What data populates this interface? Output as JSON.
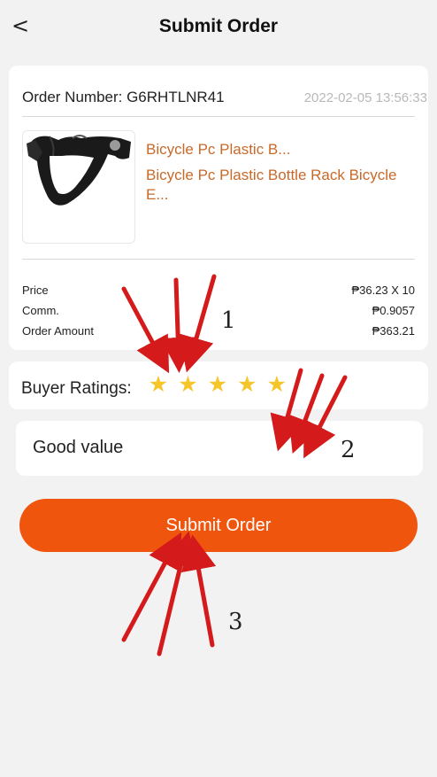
{
  "header": {
    "back_glyph": "<",
    "title": "Submit Order"
  },
  "order": {
    "number_label": "Order Number: G6RHTLNR41",
    "time": "2022-02-05 13:56:33",
    "product_title_short": "Bicycle Pc Plastic B...",
    "product_title_long": "Bicycle Pc Plastic Bottle Rack Bicycle E...",
    "product_image_icon": "bottle-cage-image",
    "summary": [
      {
        "label": "Price",
        "value": "₱36.23 X 10"
      },
      {
        "label": "Comm.",
        "value": "₱0.9057"
      },
      {
        "label": "Order Amount",
        "value": "₱363.21"
      }
    ]
  },
  "ratings": {
    "label": "Buyer Ratings:",
    "value": 5,
    "max": 5,
    "star_glyph": "★",
    "star_color": "#f6c529"
  },
  "comment": {
    "value": "Good value"
  },
  "submit": {
    "label": "Submit Order",
    "color": "#f0550e"
  },
  "annotations": {
    "numbers": [
      "1",
      "2",
      "3"
    ],
    "arrow_color": "#d41a1a"
  }
}
